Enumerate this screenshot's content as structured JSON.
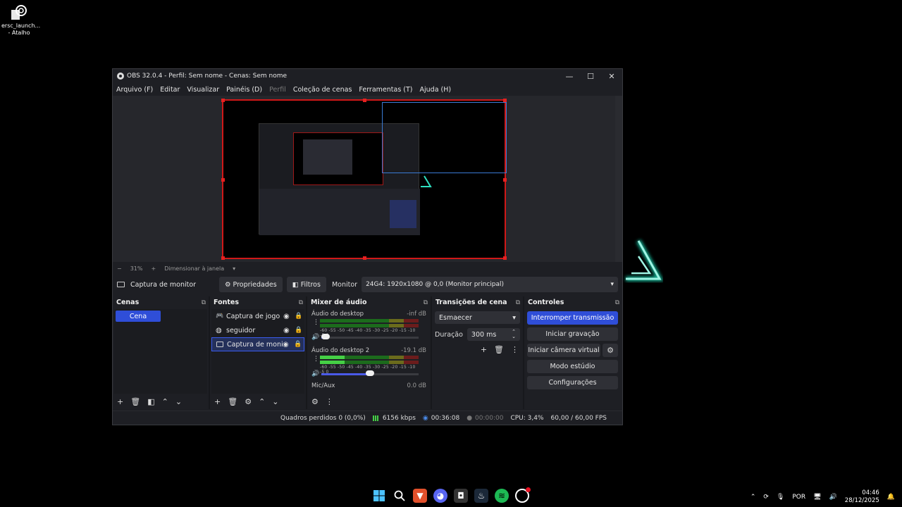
{
  "desktop": {
    "shortcut": {
      "label_line1": "ersc_launch...",
      "label_line2": "- Atalho",
      "icon": "launcher-icon"
    }
  },
  "window": {
    "title": "OBS 32.0.4 - Perfil: Sem nome - Cenas: Sem nome",
    "controls": {
      "minimize": "—",
      "maximize": "☐",
      "close": "✕"
    }
  },
  "menu": {
    "items": [
      "Arquivo (F)",
      "Editar",
      "Visualizar",
      "Painéis (D)",
      "Perfil",
      "Coleção de cenas",
      "Ferramentas (T)",
      "Ajuda (H)"
    ]
  },
  "zoom": {
    "minus": "−",
    "value": "31%",
    "plus": "+",
    "mode": "Dimensionar à janela",
    "caret": "▾"
  },
  "props": {
    "source_name": "Captura de monitor",
    "properties_button": "Propriedades",
    "filters_button": "Filtros",
    "monitor_label": "Monitor",
    "monitor_value": "24G4: 1920x1080 @ 0,0 (Monitor principal)",
    "caret": "▾"
  },
  "scenes": {
    "title": "Cenas",
    "items": [
      "Cena"
    ]
  },
  "sources": {
    "title": "Fontes",
    "items": [
      {
        "name": "Captura de jogo"
      },
      {
        "name": "seguidor"
      },
      {
        "name": "Captura de monito"
      }
    ]
  },
  "mixer": {
    "title": "Mixer de áudio",
    "channels": [
      {
        "name": "Áudio do desktop",
        "db": "-inf dB",
        "level": 0.0,
        "volume": 0.05
      },
      {
        "name": "Áudio do desktop 2",
        "db": "-19.1 dB",
        "level": 0.25,
        "volume": 0.5
      },
      {
        "name": "Mic/Aux",
        "db": "0.0 dB"
      }
    ],
    "scale": "-60 -55 -50 -45 -40 -35 -30 -25 -20 -15 -10 -5 0"
  },
  "transitions": {
    "title": "Transições de cena",
    "selected": "Esmaecer",
    "duration_label": "Duração",
    "duration_value": "300 ms"
  },
  "controls": {
    "title": "Controles",
    "stop_stream": "Interromper transmissão",
    "start_recording": "Iniciar gravação",
    "start_virtual_camera": "Iniciar câmera virtual",
    "studio_mode": "Modo estúdio",
    "settings": "Configurações"
  },
  "status": {
    "dropped_frames": "Quadros perdidos 0 (0,0%)",
    "bitrate": "6156 kbps",
    "stream_time": "00:36:08",
    "record_time": "00:00:00",
    "cpu": "CPU: 3,4%",
    "fps": "60,00 / 60,00 FPS"
  },
  "taskbar": {
    "language": "POR",
    "time": "04:46",
    "date": "28/12/2025"
  },
  "colors": {
    "accent": "#2f4ed8",
    "selection_red": "#d01818",
    "selection_blue": "#3a7bd5"
  }
}
